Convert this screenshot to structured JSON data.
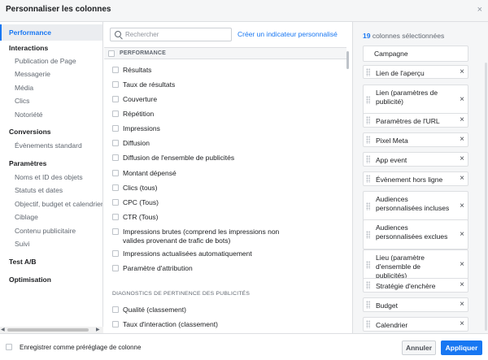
{
  "header": {
    "title": "Personnaliser les colonnes",
    "close_label": "×"
  },
  "sidebar": {
    "active": "Performance",
    "items": [
      {
        "label": "Interactions",
        "kind": "head"
      },
      {
        "label": "Publication de Page",
        "kind": "sub"
      },
      {
        "label": "Messagerie",
        "kind": "sub"
      },
      {
        "label": "Média",
        "kind": "sub"
      },
      {
        "label": "Clics",
        "kind": "sub"
      },
      {
        "label": "Notoriété",
        "kind": "sub"
      },
      {
        "label": "Conversions",
        "kind": "head"
      },
      {
        "label": "Évènements standard",
        "kind": "sub"
      },
      {
        "label": "Paramètres",
        "kind": "head"
      },
      {
        "label": "Noms et ID des objets",
        "kind": "sub"
      },
      {
        "label": "Statuts et dates",
        "kind": "sub"
      },
      {
        "label": "Objectif, budget et calendrier",
        "kind": "sub"
      },
      {
        "label": "Ciblage",
        "kind": "sub"
      },
      {
        "label": "Contenu publicitaire",
        "kind": "sub"
      },
      {
        "label": "Suivi",
        "kind": "sub"
      },
      {
        "label": "Test A/B",
        "kind": "head"
      },
      {
        "label": "Optimisation",
        "kind": "head"
      }
    ]
  },
  "search": {
    "placeholder": "Rechercher"
  },
  "create_link": "Créer un indicateur personnalisé",
  "performance_section": "PERFORMANCE",
  "metrics": [
    "Résultats",
    "Taux de résultats",
    "Couverture",
    "Répétition",
    "Impressions",
    "Diffusion",
    "Diffusion de l'ensemble de publicités",
    "Montant dépensé",
    "Clics (tous)",
    "CPC (Tous)",
    "CTR (Tous)",
    "Impressions brutes (comprend les impressions non valides provenant de trafic de bots)",
    "Impressions actualisées automatiquement",
    "Paramètre d'attribution"
  ],
  "diagnostics_section": "DIAGNOSTICS DE PERTINENCE DES PUBLICITÉS",
  "diagnostics": [
    "Qualité (classement)",
    "Taux d'interaction (classement)"
  ],
  "selected": {
    "count": "19",
    "count_label": "colonnes sélectionnées",
    "fixed": "Campagne",
    "items": [
      "Lien de l'aperçu",
      "Lien (paramètres de publicité)",
      "Paramètres de l'URL",
      "Pixel Meta",
      "App event",
      "Évènement hors ligne",
      "Audiences personnalisées incluses",
      "Audiences personnalisées exclues",
      "Lieu (paramètre d'ensemble de publicités)",
      "Stratégie d'enchère",
      "Budget",
      "Calendrier"
    ]
  },
  "footer": {
    "save_preset": "Enregistrer comme préréglage de colonne",
    "cancel": "Annuler",
    "apply": "Appliquer"
  },
  "colors": {
    "accent": "#1877f2",
    "panel": "#f5f6f7",
    "border": "#dddfe2"
  }
}
